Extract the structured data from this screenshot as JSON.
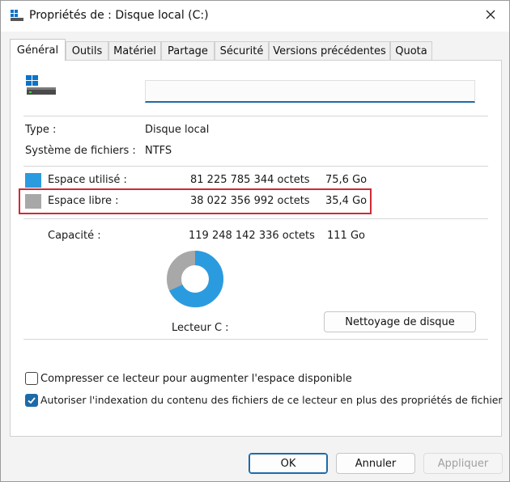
{
  "window": {
    "title": "Propriétés de : Disque local (C:)"
  },
  "tabs": [
    {
      "label": "Général",
      "active": true
    },
    {
      "label": "Outils"
    },
    {
      "label": "Matériel"
    },
    {
      "label": "Partage"
    },
    {
      "label": "Sécurité"
    },
    {
      "label": "Versions précédentes"
    },
    {
      "label": "Quota"
    }
  ],
  "general": {
    "name_value": "",
    "type_label": "Type :",
    "type_value": "Disque local",
    "fs_label": "Système de fichiers :",
    "fs_value": "NTFS",
    "used": {
      "label": "Espace utilisé :",
      "bytes": "81 225 785 344 octets",
      "size": "75,6 Go",
      "color": "#2b9be0"
    },
    "free": {
      "label": "Espace libre :",
      "bytes": "38 022 356 992 octets",
      "size": "35,4 Go",
      "color": "#a8a8a8"
    },
    "capacity": {
      "label": "Capacité :",
      "bytes": "119 248 142 336 octets",
      "size": "111 Go"
    },
    "used_fraction": 0.681,
    "drive_label": "Lecteur C :",
    "cleanup_button": "Nettoyage de disque",
    "compress_label": "Compresser ce lecteur pour augmenter l'espace disponible",
    "compress_checked": false,
    "index_label": "Autoriser l'indexation du contenu des fichiers de ce lecteur en plus des propriétés de fichier",
    "index_checked": true
  },
  "footer": {
    "ok": "OK",
    "cancel": "Annuler",
    "apply": "Appliquer"
  },
  "colors": {
    "accent": "#1d6aa8",
    "highlight_border": "#cf2a35"
  }
}
